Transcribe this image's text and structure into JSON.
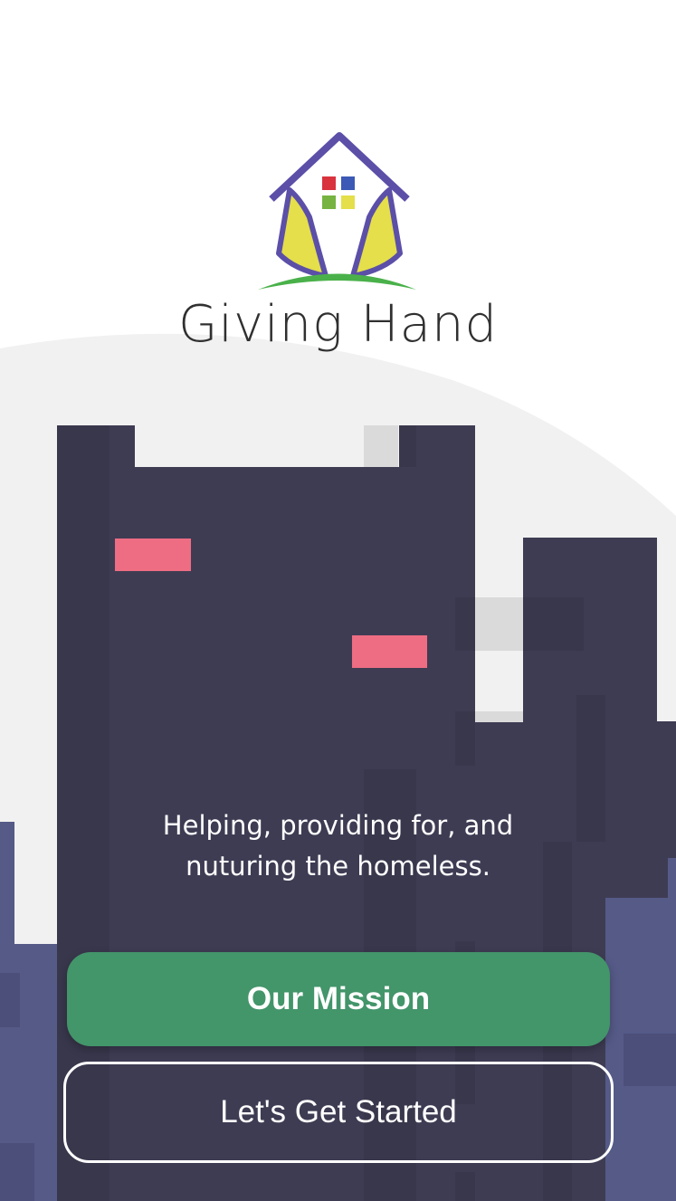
{
  "brand": {
    "name": "Giving Hand",
    "logo": "house-hands-logo"
  },
  "hero": {
    "tagline": "Helping, providing for, and nuturing the homeless."
  },
  "actions": {
    "mission_label": "Our Mission",
    "start_label": "Let's Get Started"
  },
  "colors": {
    "building_dark": "#3e3c53",
    "building_purple": "#555a87",
    "window_pink": "#ee6d83",
    "mission_green": "#43956a",
    "hill_gray": "#f1f1f1"
  }
}
